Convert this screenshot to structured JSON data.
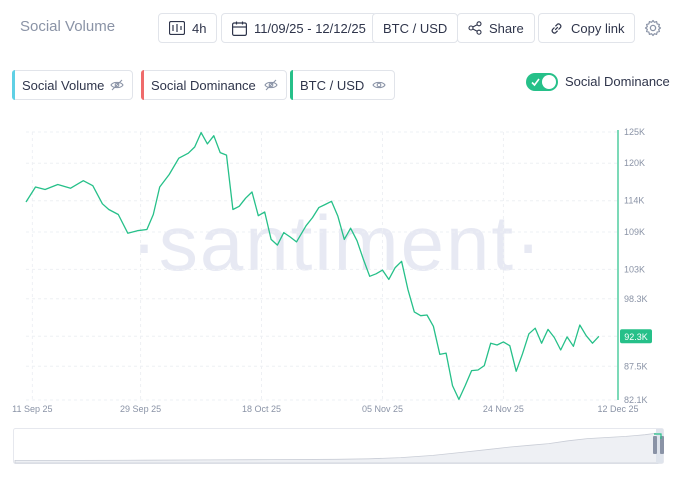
{
  "header": {
    "title": "Social Volume",
    "interval_label": "4h",
    "date_range_label": "11/09/25 - 12/12/25",
    "pair_label": "BTC / USD",
    "share_label": "Share",
    "copy_link_label": "Copy link"
  },
  "metrics": [
    {
      "label": "Social Volume",
      "color": "#5fd0e5"
    },
    {
      "label": "Social Dominance",
      "color": "#ef6b6b"
    },
    {
      "label": "BTC / USD",
      "color": "#26c089"
    }
  ],
  "toggle": {
    "label": "Social Dominance",
    "on": true
  },
  "watermark": "·santiment·",
  "chart_data": {
    "type": "line",
    "series": [
      {
        "name": "BTC / USD",
        "color": "#26c089",
        "points": [
          [
            0,
            113800
          ],
          [
            1.5,
            116200
          ],
          [
            3,
            115800
          ],
          [
            5,
            116600
          ],
          [
            7,
            116000
          ],
          [
            9,
            117200
          ],
          [
            10.5,
            116400
          ],
          [
            12,
            113500
          ],
          [
            13,
            112600
          ],
          [
            14.5,
            111800
          ],
          [
            16,
            108800
          ],
          [
            17.5,
            109200
          ],
          [
            19,
            109400
          ],
          [
            20,
            111800
          ],
          [
            21,
            116200
          ],
          [
            22.5,
            118200
          ],
          [
            24,
            120800
          ],
          [
            25.5,
            121600
          ],
          [
            26.5,
            122600
          ],
          [
            27.5,
            124900
          ],
          [
            28.5,
            123100
          ],
          [
            29.5,
            124400
          ],
          [
            30.5,
            121700
          ],
          [
            31.5,
            121300
          ],
          [
            32.5,
            112600
          ],
          [
            33.5,
            113100
          ],
          [
            34.5,
            114400
          ],
          [
            35.5,
            115400
          ],
          [
            36.5,
            111600
          ],
          [
            37.5,
            112200
          ],
          [
            38.5,
            107800
          ],
          [
            39.5,
            106900
          ],
          [
            40.5,
            108900
          ],
          [
            41.5,
            108200
          ],
          [
            42.5,
            107400
          ],
          [
            44,
            110000
          ],
          [
            45,
            111300
          ],
          [
            46,
            112900
          ],
          [
            47,
            113400
          ],
          [
            48,
            113900
          ],
          [
            49,
            111500
          ],
          [
            50,
            107800
          ],
          [
            51,
            109600
          ],
          [
            52,
            107600
          ],
          [
            53,
            104600
          ],
          [
            54,
            101900
          ],
          [
            55,
            102300
          ],
          [
            56,
            102900
          ],
          [
            57,
            101400
          ],
          [
            58,
            103300
          ],
          [
            59,
            104300
          ],
          [
            60,
            99800
          ],
          [
            61,
            96200
          ],
          [
            62,
            95600
          ],
          [
            63,
            95700
          ],
          [
            64,
            93900
          ],
          [
            65,
            89400
          ],
          [
            66,
            89600
          ],
          [
            67,
            84400
          ],
          [
            68,
            82200
          ],
          [
            69,
            84400
          ],
          [
            70,
            86800
          ],
          [
            71,
            86900
          ],
          [
            72,
            87600
          ],
          [
            73,
            91200
          ],
          [
            74,
            90900
          ],
          [
            75,
            91400
          ],
          [
            76,
            90800
          ],
          [
            77,
            86700
          ],
          [
            78,
            89500
          ],
          [
            79,
            92700
          ],
          [
            80,
            93600
          ],
          [
            81,
            91200
          ],
          [
            82,
            93400
          ],
          [
            83,
            92100
          ],
          [
            84,
            90100
          ],
          [
            85,
            92200
          ],
          [
            86,
            90700
          ],
          [
            87,
            94100
          ],
          [
            88,
            92400
          ],
          [
            89,
            91200
          ],
          [
            90,
            92300
          ]
        ]
      }
    ],
    "x_ticks": [
      {
        "x": 1,
        "label": "11 Sep 25"
      },
      {
        "x": 18,
        "label": "29 Sep 25"
      },
      {
        "x": 37,
        "label": "18 Oct 25"
      },
      {
        "x": 56,
        "label": "05 Nov 25"
      },
      {
        "x": 75,
        "label": "24 Nov 25"
      },
      {
        "x": 93,
        "label": "12 Dec 25"
      }
    ],
    "y_ticks": [
      "125K",
      "120K",
      "114K",
      "109K",
      "103K",
      "98.3K",
      "92.3K",
      "87.5K",
      "82.1K"
    ],
    "y_tick_values": [
      125000,
      120000,
      114000,
      109000,
      103000,
      98300,
      92300,
      87500,
      82100
    ],
    "xlim": [
      0,
      93
    ],
    "ylim": [
      82100,
      125000
    ],
    "last_value_label": "92.3K",
    "grid": true
  },
  "navigator": {
    "points": [
      [
        0,
        0.02
      ],
      [
        10,
        0.02
      ],
      [
        20,
        0.03
      ],
      [
        30,
        0.04
      ],
      [
        40,
        0.05
      ],
      [
        50,
        0.06
      ],
      [
        55,
        0.08
      ],
      [
        60,
        0.12
      ],
      [
        65,
        0.2
      ],
      [
        70,
        0.32
      ],
      [
        74,
        0.42
      ],
      [
        77,
        0.5
      ],
      [
        80,
        0.56
      ],
      [
        83,
        0.62
      ],
      [
        86,
        0.72
      ],
      [
        89,
        0.8
      ],
      [
        92,
        0.84
      ],
      [
        95,
        0.88
      ],
      [
        98,
        0.94
      ],
      [
        100,
        1.0
      ]
    ]
  }
}
